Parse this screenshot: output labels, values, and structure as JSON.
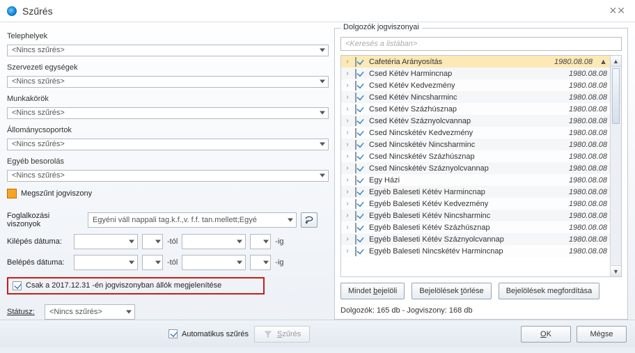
{
  "window": {
    "title": "Szűrés"
  },
  "filters": {
    "telephelyek": {
      "label": "Telephelyek",
      "value": "<Nincs szűrés>"
    },
    "szervezeti_egysegek": {
      "label": "Szervezeti egységek",
      "value": "<Nincs szűrés>"
    },
    "munkakorok": {
      "label": "Munkakörök",
      "value": "<Nincs szűrés>"
    },
    "allomanycsoportok": {
      "label": "Állománycsoportok",
      "value": "<Nincs szűrés>"
    },
    "egyeb_besorolas": {
      "label": "Egyéb besorolás",
      "value": "<Nincs szűrés>"
    },
    "megszunt_jogviszony": {
      "label": "Megszűnt jogviszony"
    },
    "foglalkozasi_viszonyok": {
      "label": "Foglalkozási viszonyok",
      "value": "Egyéni váll nappali tag.k.f.,v. f.f. tan.mellett;Egyé"
    },
    "kilepes": {
      "label": "Kilépés dátuma:",
      "from": "",
      "from_suffix": "-tól",
      "to": "",
      "to_suffix": "-ig"
    },
    "belepes": {
      "label": "Belépés dátuma:",
      "from": "",
      "from_suffix": "-tól",
      "to": "",
      "to_suffix": "-ig"
    },
    "only_on_date": {
      "label": "Csak a 2017.12.31 -én jogviszonyban állók megjelenítése"
    },
    "status": {
      "label": "Státusz:",
      "value": "<Nincs szűrés>"
    }
  },
  "right": {
    "title": "Dolgozók jogviszonyai",
    "search_placeholder": "<Keresés a listában>",
    "rows": [
      {
        "name": "Cafetéria Arányosítás",
        "date": "1980.08.08",
        "selected": true
      },
      {
        "name": "Csed Kétév Harmincnap",
        "date": "1980.08.08"
      },
      {
        "name": "Csed Kétév Kedvezmény",
        "date": "1980.08.08"
      },
      {
        "name": "Csed Kétév Nincsharminc",
        "date": "1980.08.08"
      },
      {
        "name": "Csed Kétév Százhúsznap",
        "date": "1980.08.08"
      },
      {
        "name": "Csed Kétév Száznyolcvannap",
        "date": "1980.08.08"
      },
      {
        "name": "Csed Nincskétév Kedvezmény",
        "date": "1980.08.08"
      },
      {
        "name": "Csed Nincskétév Nincsharminc",
        "date": "1980.08.08"
      },
      {
        "name": "Csed Nincskétév Százhúsznap",
        "date": "1980.08.08"
      },
      {
        "name": "Csed Nincskétév Száznyolcvannap",
        "date": "1980.08.08"
      },
      {
        "name": "Egy Házi",
        "date": "1980.08.08"
      },
      {
        "name": "Egyéb Baleseti Kétév Harmincnap",
        "date": "1980.08.08"
      },
      {
        "name": "Egyéb Baleseti Kétév Kedvezmény",
        "date": "1980.08.08"
      },
      {
        "name": "Egyéb Baleseti Kétév Nincsharminc",
        "date": "1980.08.08"
      },
      {
        "name": "Egyéb Baleseti Kétév Százhúsznap",
        "date": "1980.08.08"
      },
      {
        "name": "Egyéb Baleseti Kétév Száznyolcvannap",
        "date": "1980.08.08"
      },
      {
        "name": "Egyéb Baleseti Nincskétév Harmincnap",
        "date": "1980.08.08"
      }
    ],
    "buttons": {
      "select_all": "Mindet bejelöli",
      "clear": "Bejelölések törlése",
      "invert": "Bejelölések megfordítása"
    },
    "count_line": "Dolgozók: 165 db - Jogviszony: 168 db"
  },
  "footer": {
    "auto_filter_label": "Automatikus szűrés",
    "filter_label": "Szűrés",
    "ok": "OK",
    "cancel": "Mégse"
  }
}
